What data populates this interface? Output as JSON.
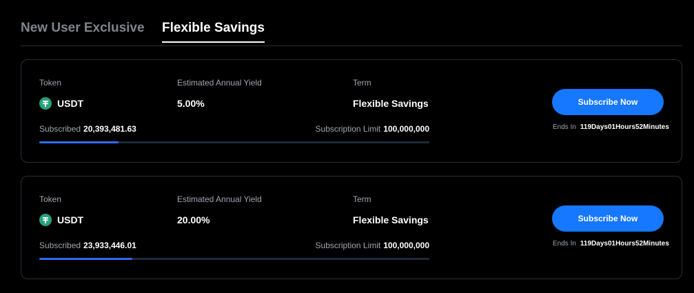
{
  "tabs": [
    {
      "label": "New User Exclusive"
    },
    {
      "label": "Flexible Savings"
    }
  ],
  "colors": {
    "accent": "#1677ff",
    "progress": "#2e6bf2",
    "token": "#26a17b"
  },
  "cards": [
    {
      "token_label": "Token",
      "token_name": "USDT",
      "token_icon": "tether-icon",
      "yield_label": "Estimated Annual Yield",
      "yield_value": "5.00%",
      "term_label": "Term",
      "term_value": "Flexible Savings",
      "subscribed_label": "Subscribed",
      "subscribed_value": "20,393,481.63",
      "limit_label": "Subscription Limit",
      "limit_value": "100,000,000",
      "progress": 0.2039,
      "button_label": "Subscribe Now",
      "ends_label": "Ends In",
      "ends_value": "119Days01Hours52Minutes"
    },
    {
      "token_label": "Token",
      "token_name": "USDT",
      "token_icon": "tether-icon",
      "yield_label": "Estimated Annual Yield",
      "yield_value": "20.00%",
      "term_label": "Term",
      "term_value": "Flexible Savings",
      "subscribed_label": "Subscribed",
      "subscribed_value": "23,933,446.01",
      "limit_label": "Subscription Limit",
      "limit_value": "100,000,000",
      "progress": 0.2393,
      "button_label": "Subscribe Now",
      "ends_label": "Ends In",
      "ends_value": "119Days01Hours52Minutes"
    }
  ]
}
